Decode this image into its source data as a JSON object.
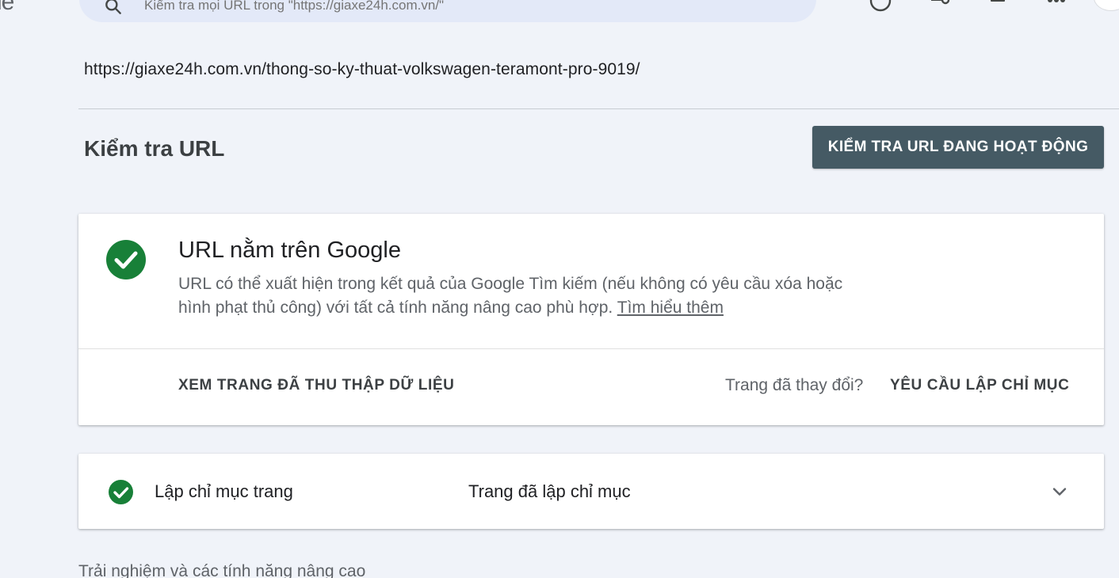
{
  "header": {
    "logo_fragment": "le",
    "search": {
      "placeholder": "Kiểm tra mọi URL trong \"https://giaxe24h.com.vn/\""
    },
    "icons": [
      "help-icon",
      "settings-icon",
      "notifications-icon",
      "apps-icon"
    ]
  },
  "inspected_url": "https://giaxe24h.com.vn/thong-so-ky-thuat-volkswagen-teramont-pro-9019/",
  "page_title": "Kiểm tra URL",
  "live_test_button": "KIỂM TRA URL ĐANG HOẠT ĐỘNG",
  "status_card": {
    "title": "URL nằm trên Google",
    "description": "URL có thể xuất hiện trong kết quả của Google Tìm kiếm (nếu không có yêu cầu xóa hoặc hình phạt thủ công) với tất cả tính năng nâng cao phù hợp.",
    "learn_more": "Tìm hiểu thêm",
    "view_crawled": "XEM TRANG ĐÃ THU THẬP DỮ LIỆU",
    "changed_question": "Trang đã thay đổi?",
    "request_indexing": "YÊU CẦU LẬP CHỈ MỤC"
  },
  "indexing_card": {
    "label": "Lập chỉ mục trang",
    "value": "Trang đã lập chỉ mục"
  },
  "footer_heading": "Trải nghiệm và các tính năng nâng cao",
  "colors": {
    "background": "#f0f3f9",
    "success_green": "#188038",
    "button_bg": "#455a64",
    "searchbar_bg": "#e3e9f8"
  }
}
